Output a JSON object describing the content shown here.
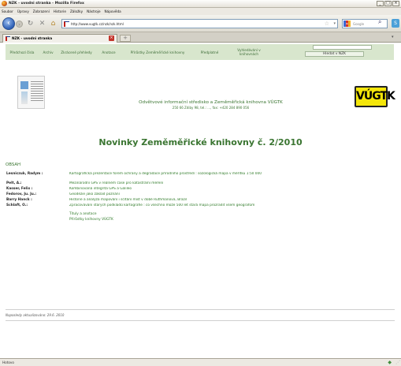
{
  "window": {
    "title": "NZK - uvodni stranka - Mozilla Firefox",
    "controls": [
      "_",
      "□",
      "×"
    ]
  },
  "menu": [
    "Soubor",
    "Úpravy",
    "Zobrazení",
    "Historie",
    "Záložky",
    "Nástroje",
    "Nápověda"
  ],
  "toolbar": {
    "url": "http://www.vugtk.cz/nzk/nzk.html",
    "search_placeholder": "Google"
  },
  "tab": {
    "label": "NZK - uvodni stranka",
    "new_tab": "+"
  },
  "site_nav": [
    "Předchozí čísla",
    "Archiv",
    "Zkrácené přehledy",
    "Anotace",
    "Přírůstky Zeměměřické knihovny",
    "Předplatné",
    "Vyhledávání v knihovnách"
  ],
  "site_search": {
    "button": "Hledat v NZK"
  },
  "logo_text": "VÚGTK",
  "org": "Odvětvové informační středisko a Zeměměřická knihovna VÚGTK",
  "address": "250 66 Zdiby 98, tel.: ..., fax: +420 284 890 056",
  "heading": "Novinky Zeměměřické knihovny č. 2/2010",
  "obsah": "OBSAH",
  "contents": [
    {
      "author": "Lesniczuk, Radym :",
      "title": "Kartografická prezentace forem ochrany a degradace přírodního prostředí : sozologická mapa v měřítku 1:50 000"
    },
    {
      "author": "Pelt, A.:",
      "title": "Mezinárodní GPS v reálném čase pro katastrální měření"
    },
    {
      "author": "Kasser, Felix :",
      "title": "Kombinovaná integrita GPS a Galileo"
    },
    {
      "author": "Fedorov, Ju. Ju.:",
      "title": "Geodézie jako základ poznání"
    },
    {
      "author": "Barry Hanck :",
      "title": "Historie a analýza mapování i sčítání míst v době Ruthmanova, Brazil"
    },
    {
      "author": "Schlaft, O.:",
      "title": "Zpracovávání starých podkladů kartografie : co všechno může 500 let stará mapa prozradit všem geografům"
    }
  ],
  "extra_links": [
    "Tituly a anotace",
    "Přírůstky knihovny VÚGTK"
  ],
  "updated": "Naposledy aktualizováno: 29.6. 2010",
  "status": "Hotovo"
}
